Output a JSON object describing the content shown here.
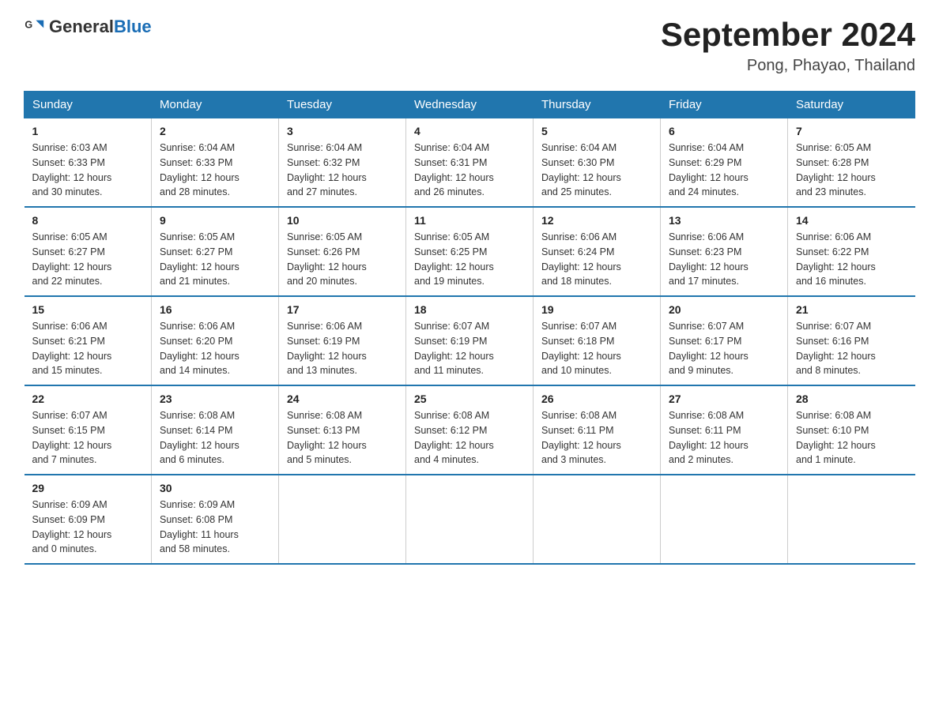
{
  "header": {
    "logo_general": "General",
    "logo_blue": "Blue",
    "title": "September 2024",
    "subtitle": "Pong, Phayao, Thailand"
  },
  "weekdays": [
    "Sunday",
    "Monday",
    "Tuesday",
    "Wednesday",
    "Thursday",
    "Friday",
    "Saturday"
  ],
  "weeks": [
    [
      {
        "day": "1",
        "sunrise": "6:03 AM",
        "sunset": "6:33 PM",
        "daylight": "12 hours and 30 minutes."
      },
      {
        "day": "2",
        "sunrise": "6:04 AM",
        "sunset": "6:33 PM",
        "daylight": "12 hours and 28 minutes."
      },
      {
        "day": "3",
        "sunrise": "6:04 AM",
        "sunset": "6:32 PM",
        "daylight": "12 hours and 27 minutes."
      },
      {
        "day": "4",
        "sunrise": "6:04 AM",
        "sunset": "6:31 PM",
        "daylight": "12 hours and 26 minutes."
      },
      {
        "day": "5",
        "sunrise": "6:04 AM",
        "sunset": "6:30 PM",
        "daylight": "12 hours and 25 minutes."
      },
      {
        "day": "6",
        "sunrise": "6:04 AM",
        "sunset": "6:29 PM",
        "daylight": "12 hours and 24 minutes."
      },
      {
        "day": "7",
        "sunrise": "6:05 AM",
        "sunset": "6:28 PM",
        "daylight": "12 hours and 23 minutes."
      }
    ],
    [
      {
        "day": "8",
        "sunrise": "6:05 AM",
        "sunset": "6:27 PM",
        "daylight": "12 hours and 22 minutes."
      },
      {
        "day": "9",
        "sunrise": "6:05 AM",
        "sunset": "6:27 PM",
        "daylight": "12 hours and 21 minutes."
      },
      {
        "day": "10",
        "sunrise": "6:05 AM",
        "sunset": "6:26 PM",
        "daylight": "12 hours and 20 minutes."
      },
      {
        "day": "11",
        "sunrise": "6:05 AM",
        "sunset": "6:25 PM",
        "daylight": "12 hours and 19 minutes."
      },
      {
        "day": "12",
        "sunrise": "6:06 AM",
        "sunset": "6:24 PM",
        "daylight": "12 hours and 18 minutes."
      },
      {
        "day": "13",
        "sunrise": "6:06 AM",
        "sunset": "6:23 PM",
        "daylight": "12 hours and 17 minutes."
      },
      {
        "day": "14",
        "sunrise": "6:06 AM",
        "sunset": "6:22 PM",
        "daylight": "12 hours and 16 minutes."
      }
    ],
    [
      {
        "day": "15",
        "sunrise": "6:06 AM",
        "sunset": "6:21 PM",
        "daylight": "12 hours and 15 minutes."
      },
      {
        "day": "16",
        "sunrise": "6:06 AM",
        "sunset": "6:20 PM",
        "daylight": "12 hours and 14 minutes."
      },
      {
        "day": "17",
        "sunrise": "6:06 AM",
        "sunset": "6:19 PM",
        "daylight": "12 hours and 13 minutes."
      },
      {
        "day": "18",
        "sunrise": "6:07 AM",
        "sunset": "6:19 PM",
        "daylight": "12 hours and 11 minutes."
      },
      {
        "day": "19",
        "sunrise": "6:07 AM",
        "sunset": "6:18 PM",
        "daylight": "12 hours and 10 minutes."
      },
      {
        "day": "20",
        "sunrise": "6:07 AM",
        "sunset": "6:17 PM",
        "daylight": "12 hours and 9 minutes."
      },
      {
        "day": "21",
        "sunrise": "6:07 AM",
        "sunset": "6:16 PM",
        "daylight": "12 hours and 8 minutes."
      }
    ],
    [
      {
        "day": "22",
        "sunrise": "6:07 AM",
        "sunset": "6:15 PM",
        "daylight": "12 hours and 7 minutes."
      },
      {
        "day": "23",
        "sunrise": "6:08 AM",
        "sunset": "6:14 PM",
        "daylight": "12 hours and 6 minutes."
      },
      {
        "day": "24",
        "sunrise": "6:08 AM",
        "sunset": "6:13 PM",
        "daylight": "12 hours and 5 minutes."
      },
      {
        "day": "25",
        "sunrise": "6:08 AM",
        "sunset": "6:12 PM",
        "daylight": "12 hours and 4 minutes."
      },
      {
        "day": "26",
        "sunrise": "6:08 AM",
        "sunset": "6:11 PM",
        "daylight": "12 hours and 3 minutes."
      },
      {
        "day": "27",
        "sunrise": "6:08 AM",
        "sunset": "6:11 PM",
        "daylight": "12 hours and 2 minutes."
      },
      {
        "day": "28",
        "sunrise": "6:08 AM",
        "sunset": "6:10 PM",
        "daylight": "12 hours and 1 minute."
      }
    ],
    [
      {
        "day": "29",
        "sunrise": "6:09 AM",
        "sunset": "6:09 PM",
        "daylight": "12 hours and 0 minutes."
      },
      {
        "day": "30",
        "sunrise": "6:09 AM",
        "sunset": "6:08 PM",
        "daylight": "11 hours and 58 minutes."
      },
      null,
      null,
      null,
      null,
      null
    ]
  ],
  "labels": {
    "sunrise": "Sunrise:",
    "sunset": "Sunset:",
    "daylight": "Daylight:"
  }
}
